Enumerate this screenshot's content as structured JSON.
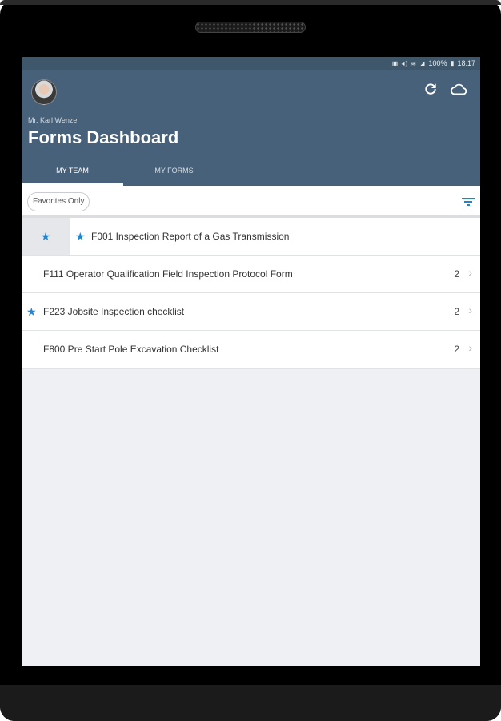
{
  "status_bar": {
    "icons": "▣ ◂) ≋ ◢",
    "battery": "100%",
    "time": "18:17"
  },
  "header": {
    "user_name": "Mr. Karl Wenzel",
    "title": "Forms Dashboard",
    "refresh_icon": "refresh-icon",
    "cloud_icon": "cloud-icon"
  },
  "tabs": [
    {
      "label": "MY TEAM",
      "active": true
    },
    {
      "label": "MY FORMS",
      "active": false
    }
  ],
  "filter": {
    "chip_label": "Favorites Only"
  },
  "forms": [
    {
      "label": "F001 Inspection Report of a Gas Transmission",
      "favorite": true,
      "count": "",
      "selected": true
    },
    {
      "label": "F111 Operator Qualification Field Inspection Protocol Form",
      "favorite": false,
      "count": "2"
    },
    {
      "label": "F223 Jobsite Inspection checklist",
      "favorite": true,
      "count": "2"
    },
    {
      "label": "F800  Pre Start Pole Excavation Checklist",
      "favorite": false,
      "count": "2"
    }
  ],
  "colors": {
    "header": "#48617a",
    "accent_star": "#1f85d0",
    "background": "#eff0f4"
  }
}
